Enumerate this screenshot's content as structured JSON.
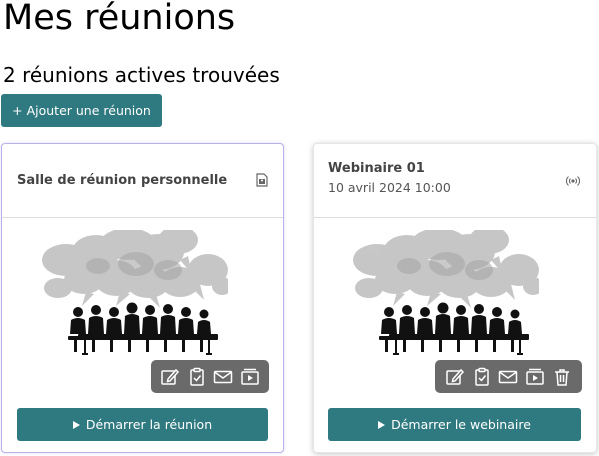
{
  "page": {
    "title": "Mes réunions",
    "subtitle": "2 réunions actives trouvées",
    "add_button": "+ Ajouter une réunion"
  },
  "colors": {
    "primary": "#2f7a80",
    "toolbar": "#6a6a6a",
    "selected_border": "#b8b3ea"
  },
  "meetings": [
    {
      "title": "Salle de réunion personnelle",
      "date": "",
      "type_icon": "document-icon",
      "actions": [
        "edit-icon",
        "clipboard-check-icon",
        "mail-icon",
        "presentation-icon"
      ],
      "start_label": "Démarrer la réunion"
    },
    {
      "title": "Webinaire 01",
      "date": "10 avril 2024 10:00",
      "type_icon": "broadcast-icon",
      "actions": [
        "edit-icon",
        "clipboard-check-icon",
        "mail-icon",
        "presentation-icon",
        "trash-icon"
      ],
      "start_label": "Démarrer le webinaire"
    }
  ]
}
